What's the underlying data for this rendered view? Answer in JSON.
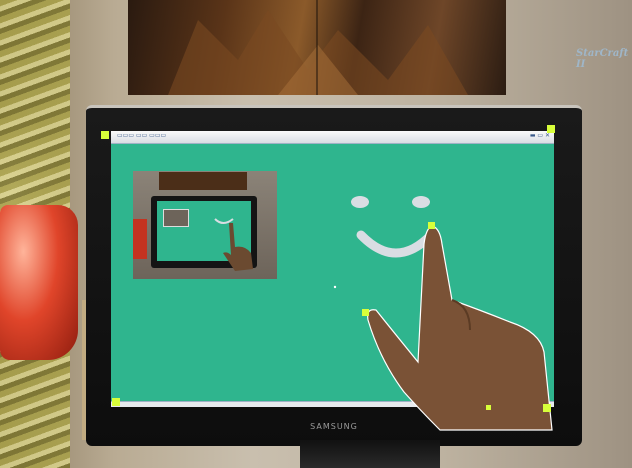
{
  "scene": {
    "wall_color": "#c9bfae",
    "screen_color": "#2fb58e",
    "lamp_color": "#e0452a"
  },
  "poster": {
    "logo_text": "StarCraft II"
  },
  "monitor": {
    "brand": "SAMSUNG"
  },
  "tracking_markers": {
    "color": "#d8ff3a",
    "icon": "corner-marker"
  },
  "drawing": {
    "stroke_color": "#d9dde3",
    "shape": "smiley-face"
  }
}
